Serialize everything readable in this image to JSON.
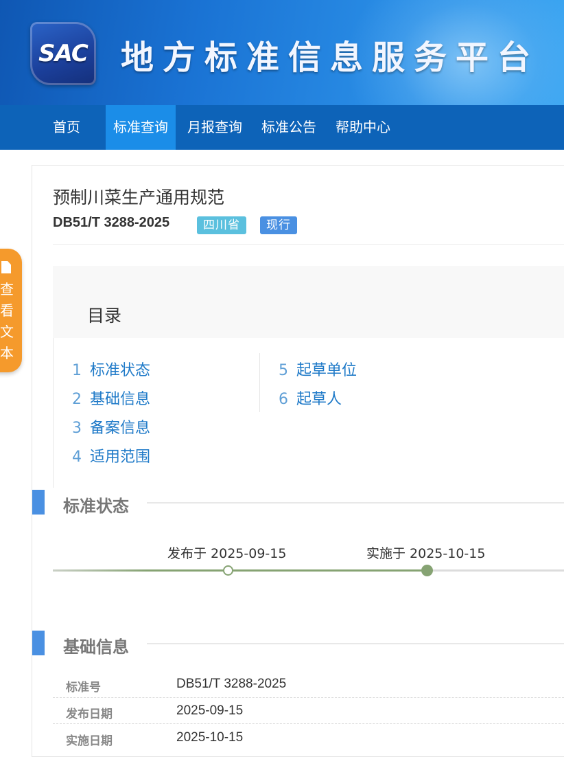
{
  "header": {
    "logo_text": "SAC",
    "site_title": "地方标准信息服务平台"
  },
  "nav": {
    "items": [
      {
        "label": "首页",
        "active": false
      },
      {
        "label": "标准查询",
        "active": true
      },
      {
        "label": "月报查询",
        "active": false
      },
      {
        "label": "标准公告",
        "active": false
      },
      {
        "label": "帮助中心",
        "active": false
      }
    ]
  },
  "side_button": {
    "icon": "document-icon",
    "label": "查看文本"
  },
  "standard": {
    "title": "预制川菜生产通用规范",
    "code": "DB51/T 3288-2025",
    "region_badge": "四川省",
    "status_badge": "现行"
  },
  "toc": {
    "title": "目录",
    "items": [
      {
        "num": "1",
        "label": "标准状态"
      },
      {
        "num": "2",
        "label": "基础信息"
      },
      {
        "num": "3",
        "label": "备案信息"
      },
      {
        "num": "4",
        "label": "适用范围"
      },
      {
        "num": "5",
        "label": "起草单位"
      },
      {
        "num": "6",
        "label": "起草人"
      }
    ]
  },
  "status_section": {
    "title": "标准状态",
    "publish_label": "发布于 2025-09-15",
    "implement_label": "实施于 2025-10-15"
  },
  "basic_section": {
    "title": "基础信息",
    "rows": [
      {
        "key": "标准号",
        "value": "DB51/T 3288-2025"
      },
      {
        "key": "发布日期",
        "value": "2025-09-15"
      },
      {
        "key": "实施日期",
        "value": "2025-10-15"
      }
    ]
  },
  "colors": {
    "nav_bg": "#0d63b8",
    "nav_active": "#1b8de8",
    "badge_region": "#5bc0de",
    "badge_status": "#4a90e2",
    "link": "#1f7ac8",
    "timeline": "#86a373",
    "side_button": "#f59a2c",
    "section_bar": "#4a90e2"
  }
}
